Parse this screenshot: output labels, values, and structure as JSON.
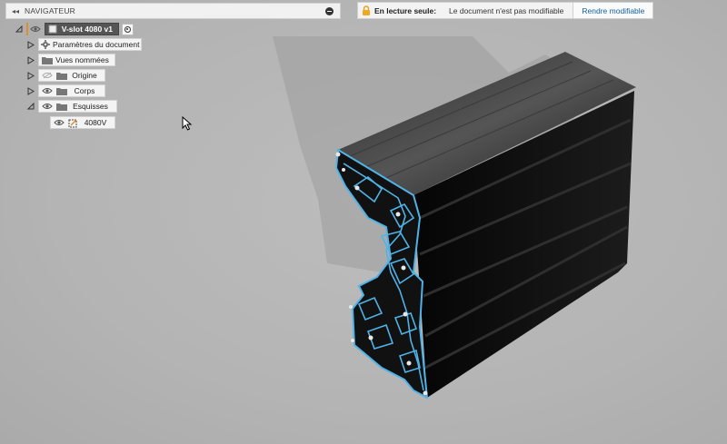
{
  "navigator": {
    "title": "NAVIGATEUR",
    "root": {
      "label": "V-slot 4080 v1"
    },
    "items": [
      {
        "label": "Paramètres du document",
        "icon": "gear-icon"
      },
      {
        "label": "Vues nommées",
        "icon": "folder-icon"
      },
      {
        "label": "Origine",
        "icon": "folder-icon"
      },
      {
        "label": "Corps",
        "icon": "folder-icon"
      },
      {
        "label": "Esquisses",
        "icon": "folder-icon"
      },
      {
        "label": "4080V",
        "icon": "sketch-icon"
      }
    ]
  },
  "readonly_banner": {
    "title": "En lecture seule:",
    "message": "Le document n'est pas modifiable",
    "button": "Rendre modifiable"
  },
  "colors": {
    "profile_body": "#0c0c0c",
    "profile_highlight": "#6e6e6e",
    "sketch_outline": "#4fb3e8",
    "viewport_bg": "#b6b6b6",
    "link": "#0e63a6"
  }
}
